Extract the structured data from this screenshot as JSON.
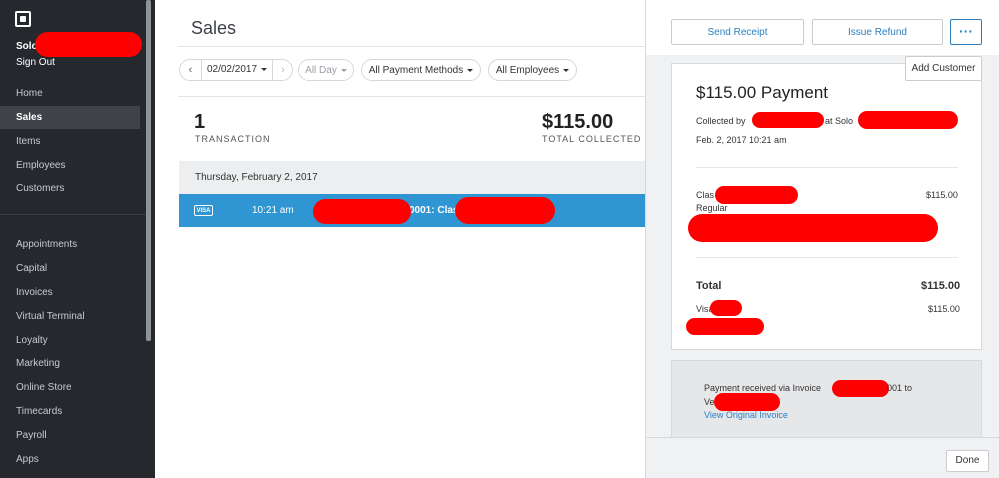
{
  "sidebar": {
    "business_name": "Solo",
    "sign_out": "Sign Out",
    "items_primary": [
      {
        "label": "Home"
      },
      {
        "label": "Sales"
      },
      {
        "label": "Items"
      },
      {
        "label": "Employees"
      },
      {
        "label": "Customers"
      }
    ],
    "active_item": "Sales",
    "items_secondary": [
      {
        "label": "Appointments"
      },
      {
        "label": "Capital"
      },
      {
        "label": "Invoices"
      },
      {
        "label": "Virtual Terminal"
      },
      {
        "label": "Loyalty"
      },
      {
        "label": "Marketing"
      },
      {
        "label": "Online Store"
      },
      {
        "label": "Timecards"
      },
      {
        "label": "Payroll"
      },
      {
        "label": "Apps"
      }
    ]
  },
  "main": {
    "title": "Sales",
    "filters": {
      "date_prev": "‹",
      "date": "02/02/2017",
      "date_next": "›",
      "time": "All Day",
      "payment_methods": "All Payment Methods",
      "employees": "All Employees"
    },
    "stats": {
      "transactions_value": "1",
      "transactions_label": "TRANSACTION",
      "collected_value": "$115.00",
      "collected_label": "TOTAL COLLECTED"
    },
    "day_header": "Thursday, February 2, 2017",
    "transaction": {
      "card_badge": "VISA",
      "time": "10:21 am",
      "description": "0001: Clas"
    }
  },
  "panel": {
    "send_receipt": "Send Receipt",
    "issue_refund": "Issue Refund",
    "more": "···",
    "add_customer": "Add Customer",
    "payment_title": "$115.00 Payment",
    "collected_by_prefix": "Collected by",
    "collected_at": "at Solo",
    "datetime": "Feb. 2, 2017 10:21 am",
    "line_item": {
      "name": "Clas",
      "variation": "Regular",
      "price": "$115.00"
    },
    "total_label": "Total",
    "total_value": "$115.00",
    "tender_label": "Visa",
    "tender_value": "$115.00",
    "note_prefix": "Payment received via Invoice",
    "note_suffix": "001 to",
    "note_line2": "Ve",
    "note_link": "View Original Invoice",
    "done": "Done"
  },
  "colors": {
    "sidebar_bg": "#25292e",
    "accent_blue": "#2f95d3",
    "link_blue": "#2a7fc0",
    "redaction": "#ff0000"
  }
}
